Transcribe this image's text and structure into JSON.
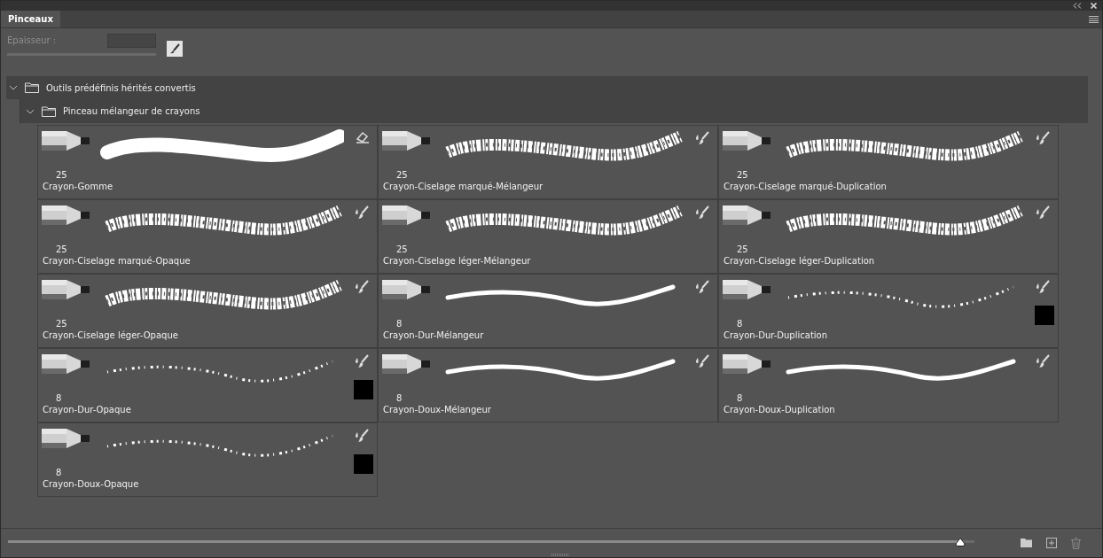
{
  "panel": {
    "tab": "Pinceaux"
  },
  "options": {
    "thickness_label": "Epaisseur :",
    "disabled": true,
    "thickness_slider": {
      "level": 1.0
    }
  },
  "tree": {
    "label": "Outils prédéfinis hérités convertis",
    "expanded": true,
    "children": [
      {
        "label": "Pinceau mélangeur de crayons",
        "expanded": true
      }
    ]
  },
  "brushes": [
    {
      "size": "25",
      "name": "Crayon-Gomme",
      "kind": "eraser",
      "swatch": false
    },
    {
      "size": "25",
      "name": "Crayon-Ciselage marqué-Mélangeur",
      "kind": "textured",
      "swatch": false
    },
    {
      "size": "25",
      "name": "Crayon-Ciselage marqué-Duplication",
      "kind": "textured",
      "swatch": false
    },
    {
      "size": "25",
      "name": "Crayon-Ciselage marqué-Opaque",
      "kind": "textured",
      "swatch": false
    },
    {
      "size": "25",
      "name": "Crayon-Ciselage léger-Mélangeur",
      "kind": "textured",
      "swatch": false
    },
    {
      "size": "25",
      "name": "Crayon-Ciselage léger-Duplication",
      "kind": "textured",
      "swatch": false
    },
    {
      "size": "25",
      "name": "Crayon-Ciselage léger-Opaque",
      "kind": "textured",
      "swatch": false
    },
    {
      "size": "8",
      "name": "Crayon-Dur-Mélangeur",
      "kind": "smooth",
      "swatch": false
    },
    {
      "size": "8",
      "name": "Crayon-Dur-Duplication",
      "kind": "sparse",
      "swatch": true
    },
    {
      "size": "8",
      "name": "Crayon-Dur-Opaque",
      "kind": "sparse",
      "swatch": true
    },
    {
      "size": "8",
      "name": "Crayon-Doux-Mélangeur",
      "kind": "smooth",
      "swatch": false
    },
    {
      "size": "8",
      "name": "Crayon-Doux-Duplication",
      "kind": "smooth",
      "swatch": false
    },
    {
      "size": "8",
      "name": "Crayon-Doux-Opaque",
      "kind": "sparse",
      "swatch": true
    }
  ],
  "footer": {
    "level": 0.985
  }
}
